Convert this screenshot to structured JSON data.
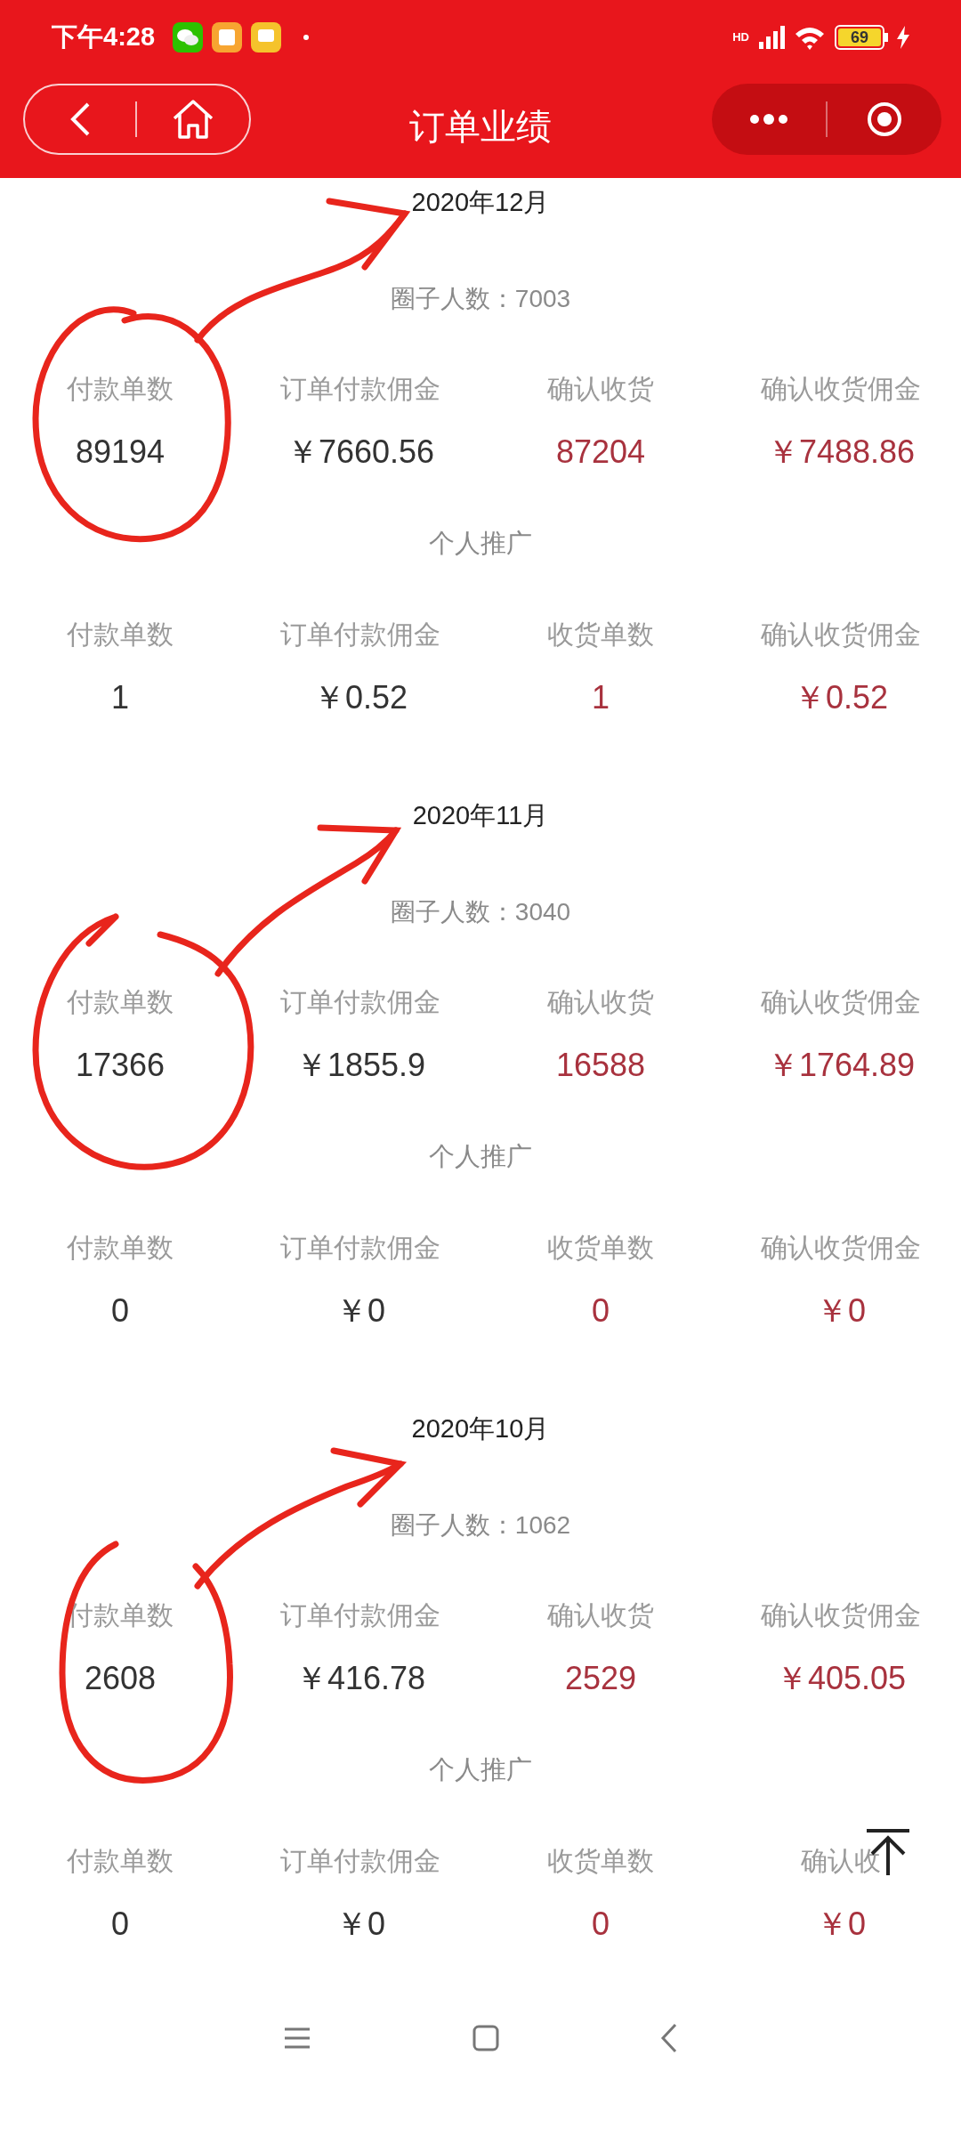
{
  "status_bar": {
    "time": "下午4:28",
    "network": "HD",
    "battery": "69"
  },
  "nav": {
    "title": "订单业绩"
  },
  "months": [
    {
      "title": "2020年12月",
      "members": "圈子人数：7003",
      "team": [
        {
          "label": "付款单数",
          "value": "89194",
          "highlight": false
        },
        {
          "label": "订单付款佣金",
          "value": "￥7660.56",
          "highlight": false
        },
        {
          "label": "确认收货",
          "value": "87204",
          "highlight": true
        },
        {
          "label": "确认收货佣金",
          "value": "￥7488.86",
          "highlight": true
        }
      ],
      "personal_title": "个人推广",
      "personal": [
        {
          "label": "付款单数",
          "value": "1",
          "highlight": false
        },
        {
          "label": "订单付款佣金",
          "value": "￥0.52",
          "highlight": false
        },
        {
          "label": "收货单数",
          "value": "1",
          "highlight": true
        },
        {
          "label": "确认收货佣金",
          "value": "￥0.52",
          "highlight": true
        }
      ]
    },
    {
      "title": "2020年11月",
      "members": "圈子人数：3040",
      "team": [
        {
          "label": "付款单数",
          "value": "17366",
          "highlight": false
        },
        {
          "label": "订单付款佣金",
          "value": "￥1855.9",
          "highlight": false
        },
        {
          "label": "确认收货",
          "value": "16588",
          "highlight": true
        },
        {
          "label": "确认收货佣金",
          "value": "￥1764.89",
          "highlight": true
        }
      ],
      "personal_title": "个人推广",
      "personal": [
        {
          "label": "付款单数",
          "value": "0",
          "highlight": false
        },
        {
          "label": "订单付款佣金",
          "value": "￥0",
          "highlight": false
        },
        {
          "label": "收货单数",
          "value": "0",
          "highlight": true
        },
        {
          "label": "确认收货佣金",
          "value": "￥0",
          "highlight": true
        }
      ]
    },
    {
      "title": "2020年10月",
      "members": "圈子人数：1062",
      "team": [
        {
          "label": "付款单数",
          "value": "2608",
          "highlight": false
        },
        {
          "label": "订单付款佣金",
          "value": "￥416.78",
          "highlight": false
        },
        {
          "label": "确认收货",
          "value": "2529",
          "highlight": true
        },
        {
          "label": "确认收货佣金",
          "value": "￥405.05",
          "highlight": true
        }
      ],
      "personal_title": "个人推广",
      "personal": [
        {
          "label": "付款单数",
          "value": "0",
          "highlight": false
        },
        {
          "label": "订单付款佣金",
          "value": "￥0",
          "highlight": false
        },
        {
          "label": "收货单数",
          "value": "0",
          "highlight": true
        },
        {
          "label": "确认收",
          "value": "￥0",
          "highlight": true
        }
      ]
    }
  ]
}
